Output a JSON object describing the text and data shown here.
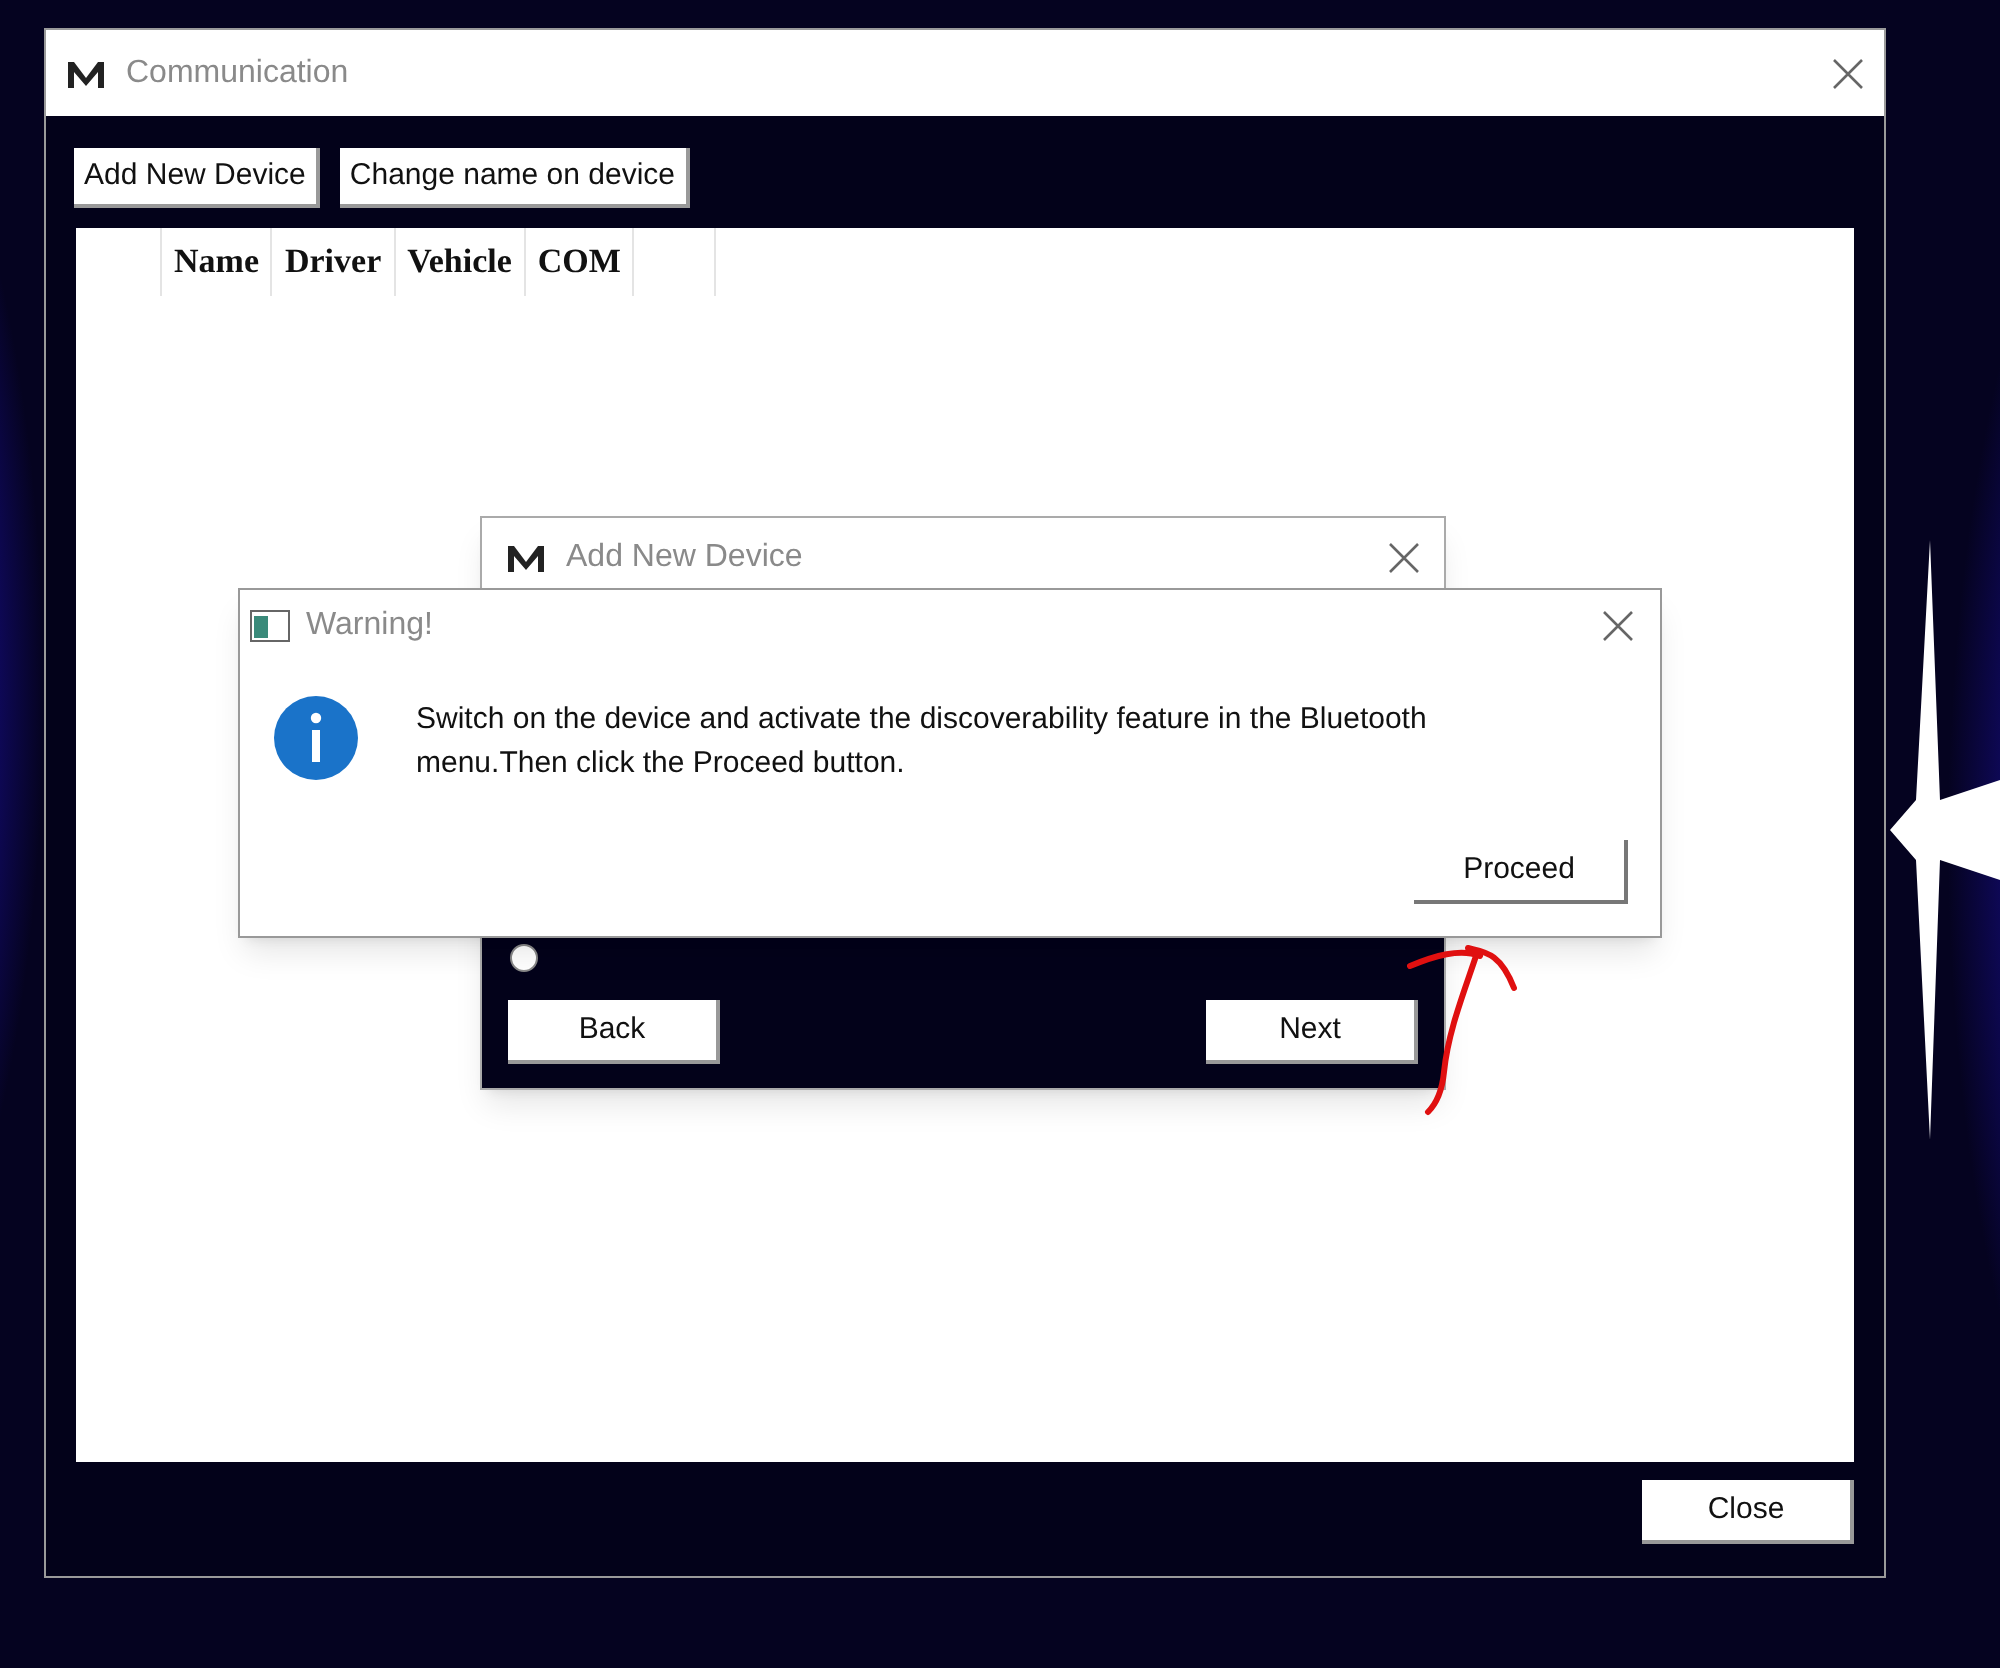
{
  "main_window": {
    "title": "Communication",
    "toolbar_buttons": [
      "Add New Device",
      "Change name on device"
    ],
    "table": {
      "columns": [
        "Name",
        "Driver",
        "Vehicle",
        "COM"
      ]
    },
    "close_button": "Close"
  },
  "add_device_dialog": {
    "title": "Add New Device",
    "options": [
      {
        "kind": "radio",
        "selected": false
      }
    ],
    "buttons": [
      "Back",
      "Next"
    ]
  },
  "warning_dialog": {
    "title": "Warning!",
    "message": "Switch on the device and activate the discoverability feature in the Bluetooth menu.Then click the Proceed button.",
    "button": "Proceed"
  }
}
